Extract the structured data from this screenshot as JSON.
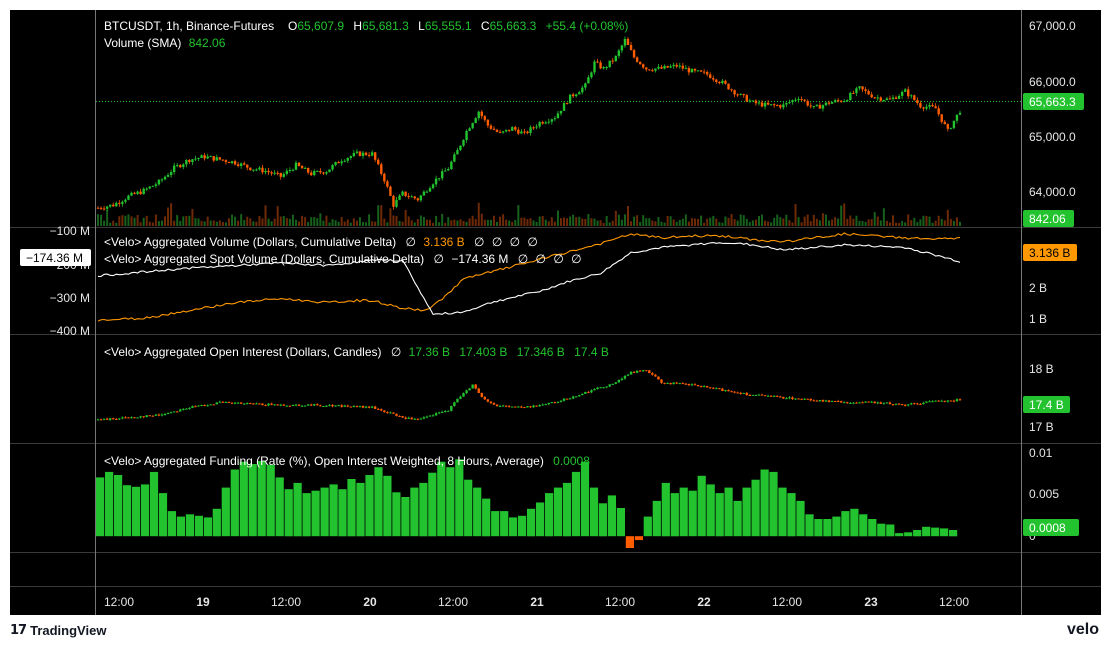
{
  "colors": {
    "up": "#22c32e",
    "down": "#ff5d00",
    "text": "#ffffff",
    "grid": "#3a3a3a",
    "cvd": "#ff9800",
    "spot": "#ffffff"
  },
  "main_legend": {
    "symbol": "BTCUSDT, 1h, Binance-Futures",
    "o_label": "O",
    "o_value": "65,607.9",
    "h_label": "H",
    "h_value": "65,681.3",
    "l_label": "L",
    "l_value": "65,555.1",
    "c_label": "C",
    "c_value": "65,663.3",
    "change": "+55.4 (+0.08%)",
    "volume_label": "Volume (SMA)",
    "volume_value": "842.06"
  },
  "cvd_legend": {
    "line1_label": "<Velo> Aggregated Volume (Dollars, Cumulative Delta)",
    "line1_value": "3.136 B",
    "line2_label": "<Velo> Aggregated Spot Volume (Dollars, Cumulative Delta)",
    "line2_value": "−174.36 M",
    "empty_mark": "∅"
  },
  "oi_legend": {
    "label": "<Velo> Aggregated Open Interest (Dollars, Candles)",
    "values": [
      "17.36 B",
      "17.403 B",
      "17.346 B",
      "17.4 B"
    ]
  },
  "funding_legend": {
    "label": "<Velo> Aggregated Funding (Rate (%), Open Interest Weighted, 8 Hours, Average)",
    "value": "0.0008"
  },
  "price_axis": {
    "ticks": [
      "67,000.0",
      "66,000.0",
      "65,000.0",
      "64,000.0"
    ],
    "last_price": "65,663.3",
    "volume_tag": "842.06"
  },
  "cvd_right_axis": {
    "ticks": [
      "2 B",
      "1 B"
    ],
    "tag": "3.136 B"
  },
  "cvd_left_axis": {
    "ticks": [
      "−100 M",
      "−200 M",
      "−300 M",
      "−400 M"
    ],
    "tag": "−174.36 M"
  },
  "oi_axis": {
    "ticks": [
      "18 B",
      "17 B"
    ],
    "tag": "17.4 B"
  },
  "funding_axis": {
    "ticks": [
      "0.01",
      "0.005",
      "0"
    ],
    "tag": "0.0008"
  },
  "time_axis": {
    "labels": [
      "12:00",
      "19",
      "12:00",
      "20",
      "12:00",
      "21",
      "12:00",
      "22",
      "12:00",
      "23",
      "12:00"
    ]
  },
  "footer": {
    "brand": "TradingView",
    "brand_mark": "17",
    "watermark": "velo"
  },
  "chart_data": [
    {
      "type": "candlestick",
      "title": "BTCUSDT, 1h, Binance-Futures",
      "y_axis": [
        63700,
        67150
      ],
      "close_anchors": [
        [
          0,
          63950
        ],
        [
          5,
          64000
        ],
        [
          10,
          64150
        ],
        [
          15,
          64250
        ],
        [
          20,
          64400
        ],
        [
          25,
          64650
        ],
        [
          30,
          64800
        ],
        [
          35,
          64850
        ],
        [
          40,
          64800
        ],
        [
          45,
          64750
        ],
        [
          50,
          64650
        ],
        [
          55,
          64600
        ],
        [
          60,
          64500
        ],
        [
          65,
          64700
        ],
        [
          70,
          64550
        ],
        [
          75,
          64600
        ],
        [
          80,
          64800
        ],
        [
          85,
          64900
        ],
        [
          90,
          64900
        ],
        [
          94,
          64450
        ],
        [
          97,
          64000
        ],
        [
          100,
          64200
        ],
        [
          105,
          64100
        ],
        [
          110,
          64400
        ],
        [
          115,
          64650
        ],
        [
          118,
          64950
        ],
        [
          121,
          65300
        ],
        [
          125,
          65650
        ],
        [
          128,
          65400
        ],
        [
          132,
          65250
        ],
        [
          136,
          65350
        ],
        [
          140,
          65250
        ],
        [
          145,
          65450
        ],
        [
          150,
          65550
        ],
        [
          155,
          65900
        ],
        [
          160,
          66100
        ],
        [
          163,
          66500
        ],
        [
          166,
          66400
        ],
        [
          170,
          66600
        ],
        [
          173,
          66900
        ],
        [
          176,
          66600
        ],
        [
          180,
          66400
        ],
        [
          185,
          66400
        ],
        [
          190,
          66450
        ],
        [
          195,
          66350
        ],
        [
          200,
          66300
        ],
        [
          205,
          66150
        ],
        [
          210,
          65950
        ],
        [
          215,
          65800
        ],
        [
          220,
          65750
        ],
        [
          225,
          65750
        ],
        [
          230,
          65900
        ],
        [
          235,
          65700
        ],
        [
          240,
          65800
        ],
        [
          245,
          65850
        ],
        [
          250,
          66050
        ],
        [
          255,
          65900
        ],
        [
          260,
          65850
        ],
        [
          265,
          66000
        ],
        [
          270,
          65750
        ],
        [
          275,
          65700
        ],
        [
          279,
          65300
        ],
        [
          283,
          65663
        ]
      ]
    },
    {
      "type": "bar",
      "title": "Volume (SMA)",
      "last_value": 842.06,
      "y_axis": [
        0,
        1
      ]
    },
    {
      "type": "line",
      "series": [
        {
          "name": "<Velo> Aggregated Volume (Dollars, Cumulative Delta)",
          "last_value": "3.136 B",
          "y_axis": [
            0.8,
            3.3
          ],
          "anchors": [
            [
              0,
              1.05
            ],
            [
              15,
              1.1
            ],
            [
              30,
              1.3
            ],
            [
              45,
              1.5
            ],
            [
              60,
              1.6
            ],
            [
              75,
              1.5
            ],
            [
              85,
              1.55
            ],
            [
              90,
              1.55
            ],
            [
              100,
              1.35
            ],
            [
              108,
              1.3
            ],
            [
              113,
              1.6
            ],
            [
              120,
              2.1
            ],
            [
              130,
              2.3
            ],
            [
              145,
              2.6
            ],
            [
              155,
              2.8
            ],
            [
              165,
              3.0
            ],
            [
              175,
              3.25
            ],
            [
              185,
              3.15
            ],
            [
              195,
              3.2
            ],
            [
              205,
              3.2
            ],
            [
              215,
              3.1
            ],
            [
              225,
              3.05
            ],
            [
              235,
              3.15
            ],
            [
              245,
              3.25
            ],
            [
              255,
              3.2
            ],
            [
              265,
              3.15
            ],
            [
              275,
              3.12
            ],
            [
              283,
              3.136
            ]
          ]
        },
        {
          "name": "<Velo> Aggregated Spot Volume (Dollars, Cumulative Delta)",
          "last_value": "−174.36 M",
          "y_axis": [
            -440,
            -60
          ],
          "anchors": [
            [
              0,
              -230
            ],
            [
              10,
              -220
            ],
            [
              20,
              -210
            ],
            [
              30,
              -200
            ],
            [
              45,
              -190
            ],
            [
              60,
              -180
            ],
            [
              75,
              -190
            ],
            [
              90,
              -170
            ],
            [
              100,
              -170
            ],
            [
              110,
              -380
            ],
            [
              120,
              -370
            ],
            [
              130,
              -330
            ],
            [
              145,
              -290
            ],
            [
              155,
              -250
            ],
            [
              165,
              -220
            ],
            [
              175,
              -140
            ],
            [
              185,
              -120
            ],
            [
              195,
              -110
            ],
            [
              205,
              -100
            ],
            [
              215,
              -110
            ],
            [
              225,
              -130
            ],
            [
              235,
              -120
            ],
            [
              245,
              -110
            ],
            [
              255,
              -115
            ],
            [
              265,
              -120
            ],
            [
              275,
              -150
            ],
            [
              283,
              -174.36
            ]
          ]
        }
      ]
    },
    {
      "type": "candlestick",
      "title": "<Velo> Aggregated Open Interest (Dollars, Candles)",
      "o": 17.36,
      "h": 17.403,
      "l": 17.346,
      "c": 17.4,
      "y_axis": [
        16.6,
        18.6
      ],
      "close_anchors": [
        [
          0,
          17.0
        ],
        [
          10,
          17.05
        ],
        [
          20,
          17.1
        ],
        [
          30,
          17.25
        ],
        [
          40,
          17.35
        ],
        [
          50,
          17.32
        ],
        [
          60,
          17.3
        ],
        [
          70,
          17.3
        ],
        [
          80,
          17.28
        ],
        [
          90,
          17.25
        ],
        [
          95,
          17.15
        ],
        [
          100,
          17.05
        ],
        [
          105,
          17.0
        ],
        [
          110,
          17.1
        ],
        [
          115,
          17.2
        ],
        [
          120,
          17.55
        ],
        [
          123,
          17.7
        ],
        [
          126,
          17.45
        ],
        [
          130,
          17.3
        ],
        [
          140,
          17.25
        ],
        [
          150,
          17.35
        ],
        [
          160,
          17.55
        ],
        [
          170,
          17.75
        ],
        [
          175,
          17.95
        ],
        [
          180,
          18.0
        ],
        [
          185,
          17.75
        ],
        [
          195,
          17.7
        ],
        [
          205,
          17.6
        ],
        [
          215,
          17.5
        ],
        [
          225,
          17.45
        ],
        [
          235,
          17.4
        ],
        [
          245,
          17.35
        ],
        [
          255,
          17.35
        ],
        [
          265,
          17.3
        ],
        [
          275,
          17.38
        ],
        [
          283,
          17.4
        ]
      ]
    },
    {
      "type": "bar",
      "title": "<Velo> Aggregated Funding (Rate (%), Open Interest Weighted, 8 Hours, Average)",
      "last_value": 0.0008,
      "y_axis": [
        -0.0015,
        0.0115
      ],
      "x_labels": [
        "12:00",
        "19",
        "12:00",
        "20",
        "12:00",
        "21",
        "12:00",
        "22",
        "12:00",
        "23",
        "12:00"
      ],
      "values": [
        0.0075,
        0.0082,
        0.0078,
        0.0065,
        0.0063,
        0.0066,
        0.0082,
        0.0055,
        0.0032,
        0.0025,
        0.0028,
        0.0026,
        0.0024,
        0.0035,
        0.0062,
        0.0085,
        0.0095,
        0.0092,
        0.0096,
        0.0091,
        0.0075,
        0.006,
        0.0068,
        0.0055,
        0.0058,
        0.0062,
        0.0066,
        0.006,
        0.0073,
        0.0068,
        0.0078,
        0.0088,
        0.0077,
        0.0056,
        0.005,
        0.0062,
        0.0068,
        0.0081,
        0.0095,
        0.0088,
        0.0098,
        0.0072,
        0.0062,
        0.0048,
        0.0032,
        0.0032,
        0.0024,
        0.0026,
        0.0035,
        0.0043,
        0.0055,
        0.0062,
        0.0068,
        0.0082,
        0.0095,
        0.0062,
        0.0042,
        0.0052,
        0.0036,
        -0.0015,
        -0.0005,
        0.0025,
        0.0045,
        0.0068,
        0.0055,
        0.0062,
        0.0058,
        0.0077,
        0.0066,
        0.0055,
        0.0062,
        0.0045,
        0.0062,
        0.0072,
        0.0085,
        0.0082,
        0.0062,
        0.0055,
        0.0045,
        0.0028,
        0.0022,
        0.0022,
        0.0025,
        0.0032,
        0.0035,
        0.0028,
        0.0022,
        0.0016,
        0.0015,
        0.0004,
        0.0005,
        0.0008,
        0.0012,
        0.0011,
        0.001,
        0.0008
      ]
    }
  ]
}
